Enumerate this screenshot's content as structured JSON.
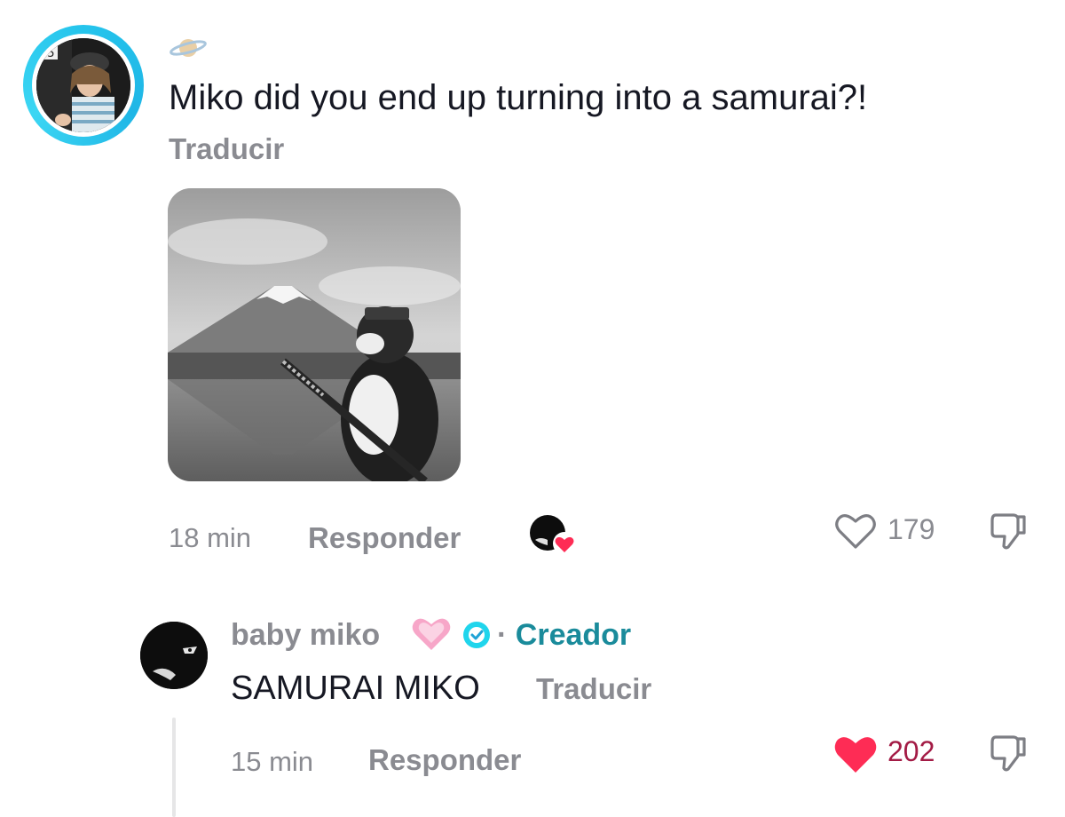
{
  "comment": {
    "avatar": "user-avatar-photo",
    "emoji_icon": "ringed-planet-icon",
    "text": "Miko did you end up turning into a samurai?!",
    "translate_label": "Traducir",
    "image": "samurai-cat-mount-fuji-photo",
    "time": "18 min",
    "reply_label": "Responder",
    "creator_liked_icon": "creator-liked-heart-icon",
    "like_icon": "heart-outline-icon",
    "like_count": "179",
    "dislike_icon": "thumbs-down-icon"
  },
  "reply": {
    "avatar": "creator-avatar",
    "username": "baby miko",
    "emoji_icon": "pink-heart-icon",
    "verified_icon": "verified-badge-icon",
    "separator": "·",
    "creator_label": "Creador",
    "text": "SAMURAI MIKO",
    "translate_label": "Traducir",
    "time": "15 min",
    "reply_label": "Responder",
    "like_icon": "heart-filled-icon",
    "like_count": "202",
    "dislike_icon": "thumbs-down-icon"
  },
  "colors": {
    "ring": "#25c4ec",
    "muted_text": "#8a8b91",
    "creator_label": "#1a8b9b",
    "liked_heart": "#fe2c55",
    "liked_count": "#a31b45"
  }
}
